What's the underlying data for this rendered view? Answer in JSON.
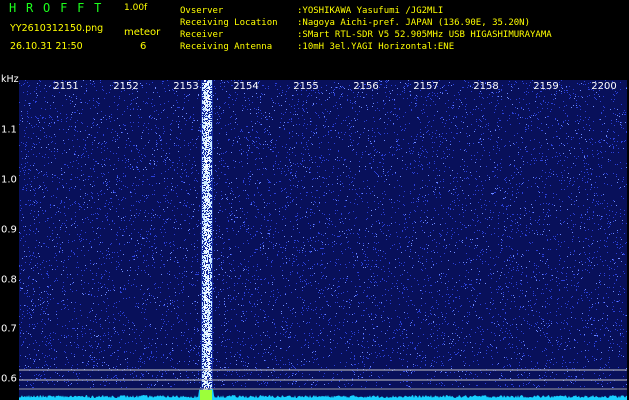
{
  "header": {
    "title": "HROFFT",
    "version": "1.00f",
    "filename": "YY2610312150.png",
    "timestamp": "26.10.31 21:50",
    "meteor_label": "meteor",
    "meteor_count": "6"
  },
  "info": {
    "observer_label": "Ovserver",
    "observer_value": ":YOSHIKAWA Yasufumi /JG2MLI",
    "location_label": "Receiving Location",
    "location_value": ":Nagoya Aichi-pref. JAPAN (136.90E, 35.20N)",
    "receiver_label": "Receiver",
    "receiver_value": ":SMart RTL-SDR V5 52.905MHz USB HIGASHIMURAYAMA",
    "antenna_label": "Receiving Antenna",
    "antenna_value": ":10mH 3el.YAGI Horizontal:ENE"
  },
  "axis": {
    "y_unit": "kHz",
    "x_ticks": [
      "2151",
      "2152",
      "2153",
      "2154",
      "2155",
      "2156",
      "2157",
      "2158",
      "2159",
      "2200"
    ],
    "y_ticks": [
      "1.1",
      "1.0",
      "0.9",
      "0.8",
      "0.7",
      "0.6"
    ]
  },
  "colors": {
    "background": "#000000",
    "text_header": "#ffff00",
    "title_green": "#1cff1c",
    "plot_bg": "#08105a",
    "noise_blue": "#2a40d8",
    "noise_bright": "#6f8cff",
    "signal": "#c8e8ff",
    "baseline": "#18d0ff"
  }
}
